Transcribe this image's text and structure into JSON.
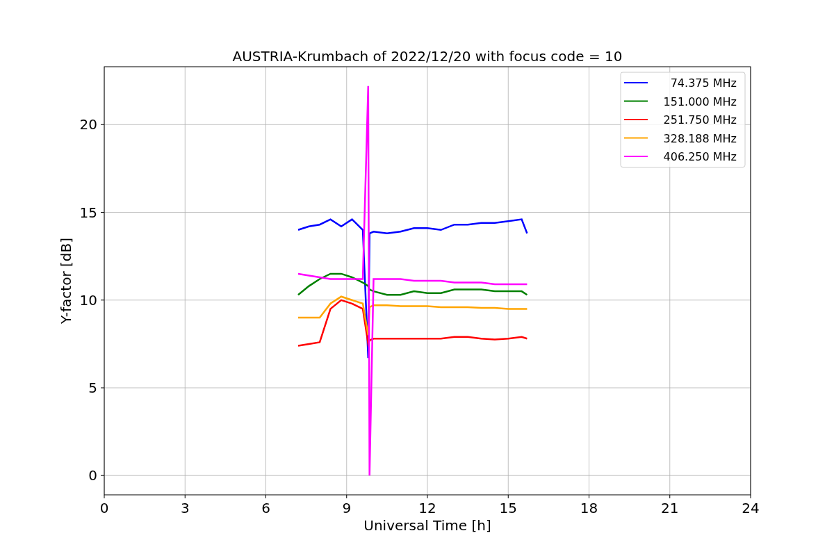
{
  "chart_data": {
    "type": "line",
    "title": "AUSTRIA-Krumbach of 2022/12/20 with focus code = 10",
    "xlabel": "Universal Time [h]",
    "ylabel": "Y-factor [dB]",
    "x": [
      7.2,
      7.6,
      8.0,
      8.4,
      8.8,
      9.2,
      9.6,
      9.8,
      9.85,
      10.0,
      10.5,
      11,
      11.5,
      12,
      12.5,
      13,
      13.5,
      14,
      14.5,
      15,
      15.5,
      15.7
    ],
    "xlim": [
      0,
      24
    ],
    "ylim": [
      -1.1,
      23.3
    ],
    "xticks": [
      0,
      3,
      6,
      9,
      12,
      15,
      18,
      21,
      24
    ],
    "grid": true,
    "legend": true,
    "yticks": [
      0,
      5,
      10,
      15,
      20
    ],
    "series": [
      {
        "name": "74.375 MHz",
        "color": "#0000ff",
        "values": [
          14.0,
          14.2,
          14.3,
          14.6,
          14.2,
          14.6,
          14.0,
          6.7,
          13.8,
          13.9,
          13.8,
          13.9,
          14.1,
          14.1,
          14.0,
          14.3,
          14.3,
          14.4,
          14.4,
          14.5,
          14.6,
          13.8
        ]
      },
      {
        "name": "151.000 MHz",
        "color": "#008000",
        "values": [
          10.3,
          10.8,
          11.2,
          11.5,
          11.5,
          11.3,
          11.0,
          10.8,
          10.6,
          10.5,
          10.3,
          10.3,
          10.5,
          10.4,
          10.4,
          10.6,
          10.6,
          10.6,
          10.5,
          10.5,
          10.5,
          10.3
        ]
      },
      {
        "name": "251.750 MHz",
        "color": "#ff0000",
        "values": [
          7.4,
          7.5,
          7.6,
          9.5,
          10.0,
          9.8,
          9.5,
          7.5,
          7.7,
          7.8,
          7.8,
          7.8,
          7.8,
          7.8,
          7.8,
          7.9,
          7.9,
          7.8,
          7.75,
          7.8,
          7.9,
          7.8
        ]
      },
      {
        "name": "328.188 MHz",
        "color": "#ffa500",
        "values": [
          9.0,
          9.0,
          9.0,
          9.8,
          10.2,
          10.0,
          9.8,
          8.0,
          9.6,
          9.7,
          9.7,
          9.65,
          9.65,
          9.65,
          9.6,
          9.6,
          9.6,
          9.55,
          9.55,
          9.5,
          9.5,
          9.5
        ]
      },
      {
        "name": "406.250 MHz",
        "color": "#ff00ff",
        "values": [
          11.5,
          11.4,
          11.3,
          11.2,
          11.2,
          11.2,
          11.2,
          22.2,
          0,
          11.2,
          11.2,
          11.2,
          11.1,
          11.1,
          11.1,
          11.0,
          11.0,
          11.0,
          10.9,
          10.9,
          10.9,
          10.9
        ]
      }
    ]
  }
}
